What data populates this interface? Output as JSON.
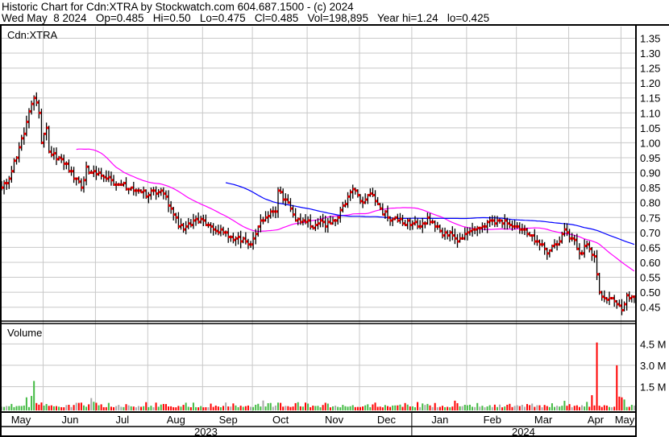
{
  "header": {
    "title": "Historic Chart for Cdn:XTRA by Stockwatch.com 604.687.1500 - (c) 2024",
    "quote": "Wed May  8 2024   Op=0.485   Hi=0.50   Lo=0.475   Cl=0.485   Vol=198,895   Year hi=1.24   lo=0.425"
  },
  "price_panel_label": "Cdn:XTRA",
  "volume_panel_label": "Volume",
  "colors": {
    "bar": "#000000",
    "close_tick": "#ff0000",
    "ma_short": "#ff00ff",
    "ma_long": "#0000ff",
    "vol_up": "#44bb44",
    "vol_down": "#ff0000",
    "vol_flat": "#aaaaaa",
    "grid": "#c8c8c8"
  },
  "chart_data": {
    "type": "ohlc",
    "symbol": "Cdn:XTRA",
    "price_axis": {
      "min": 0.45,
      "max": 1.35,
      "step": 0.05,
      "labels": [
        "1.35",
        "1.30",
        "1.25",
        "1.20",
        "1.15",
        "1.10",
        "1.05",
        "1.00",
        "0.95",
        "0.90",
        "0.85",
        "0.80",
        "0.75",
        "0.70",
        "0.65",
        "0.60",
        "0.55",
        "0.50",
        "0.45"
      ]
    },
    "volume_axis": {
      "labels": [
        "4.5 M",
        "3.0 M",
        "1.5 M"
      ],
      "values_millions": [
        4.5,
        3.0,
        1.5
      ]
    },
    "months": [
      "May",
      "Jun",
      "Jul",
      "Aug",
      "Sep",
      "Oct",
      "Nov",
      "Dec",
      "Jan",
      "Feb",
      "Mar",
      "Apr",
      "May"
    ],
    "month_start_day": [
      0,
      17,
      38,
      59,
      81,
      101,
      123,
      144,
      165,
      187,
      207,
      228,
      249
    ],
    "years": [
      "2023",
      "2024"
    ],
    "trading_days": 255,
    "close_keypoints": [
      [
        0,
        0.85
      ],
      [
        3,
        0.88
      ],
      [
        6,
        0.95
      ],
      [
        10,
        1.07
      ],
      [
        13,
        1.15
      ],
      [
        15,
        1.1
      ],
      [
        16,
        1.0
      ],
      [
        18,
        1.05
      ],
      [
        19,
        0.97
      ],
      [
        23,
        0.95
      ],
      [
        26,
        0.93
      ],
      [
        29,
        0.88
      ],
      [
        32,
        0.85
      ],
      [
        34,
        0.92
      ],
      [
        35,
        0.9
      ],
      [
        39,
        0.9
      ],
      [
        42,
        0.88
      ],
      [
        45,
        0.86
      ],
      [
        48,
        0.86
      ],
      [
        52,
        0.85
      ],
      [
        55,
        0.84
      ],
      [
        58,
        0.82
      ],
      [
        61,
        0.84
      ],
      [
        65,
        0.83
      ],
      [
        68,
        0.78
      ],
      [
        71,
        0.72
      ],
      [
        74,
        0.72
      ],
      [
        77,
        0.74
      ],
      [
        81,
        0.74
      ],
      [
        84,
        0.72
      ],
      [
        87,
        0.7
      ],
      [
        90,
        0.7
      ],
      [
        94,
        0.68
      ],
      [
        97,
        0.68
      ],
      [
        100,
        0.66
      ],
      [
        103,
        0.72
      ],
      [
        106,
        0.75
      ],
      [
        110,
        0.77
      ],
      [
        111,
        0.84
      ],
      [
        115,
        0.8
      ],
      [
        118,
        0.74
      ],
      [
        121,
        0.74
      ],
      [
        124,
        0.72
      ],
      [
        127,
        0.73
      ],
      [
        132,
        0.73
      ],
      [
        135,
        0.75
      ],
      [
        139,
        0.82
      ],
      [
        142,
        0.84
      ],
      [
        145,
        0.8
      ],
      [
        148,
        0.83
      ],
      [
        152,
        0.78
      ],
      [
        155,
        0.75
      ],
      [
        158,
        0.75
      ],
      [
        161,
        0.73
      ],
      [
        165,
        0.73
      ],
      [
        168,
        0.72
      ],
      [
        171,
        0.75
      ],
      [
        174,
        0.72
      ],
      [
        177,
        0.69
      ],
      [
        181,
        0.69
      ],
      [
        184,
        0.68
      ],
      [
        187,
        0.7
      ],
      [
        190,
        0.71
      ],
      [
        194,
        0.72
      ],
      [
        197,
        0.74
      ],
      [
        200,
        0.74
      ],
      [
        203,
        0.73
      ],
      [
        206,
        0.72
      ],
      [
        210,
        0.71
      ],
      [
        213,
        0.69
      ],
      [
        216,
        0.66
      ],
      [
        219,
        0.63
      ],
      [
        223,
        0.66
      ],
      [
        226,
        0.71
      ],
      [
        229,
        0.68
      ],
      [
        232,
        0.63
      ],
      [
        235,
        0.66
      ],
      [
        238,
        0.62
      ],
      [
        239,
        0.56
      ],
      [
        240,
        0.5
      ],
      [
        244,
        0.48
      ],
      [
        247,
        0.46
      ],
      [
        249,
        0.44
      ],
      [
        251,
        0.49
      ],
      [
        254,
        0.485
      ]
    ],
    "volume_spikes_millions": [
      [
        13,
        1.9
      ],
      [
        12,
        0.85
      ],
      [
        10,
        0.75
      ],
      [
        36,
        0.7
      ],
      [
        239,
        4.6
      ],
      [
        237,
        0.9
      ],
      [
        247,
        3.0
      ],
      [
        248,
        0.8
      ],
      [
        249,
        0.75
      ],
      [
        250,
        0.6
      ]
    ],
    "moving_averages": [
      {
        "name": "short",
        "period": 30
      },
      {
        "name": "long",
        "period": 90
      }
    ]
  }
}
